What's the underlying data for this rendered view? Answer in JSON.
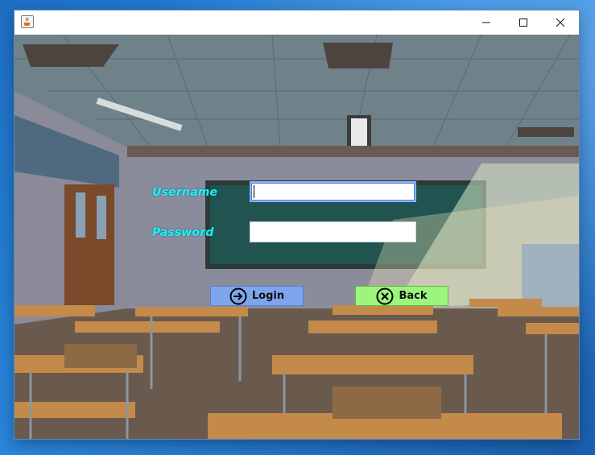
{
  "window": {
    "title": "",
    "app_icon": "java-cup-icon",
    "controls": [
      "minimize-icon",
      "maximize-icon",
      "close-icon"
    ]
  },
  "form": {
    "username_label": "Username",
    "password_label": "Password",
    "username_value": "",
    "password_value": ""
  },
  "buttons": {
    "login_label": "Login",
    "login_icon": "arrow-right-circle-icon",
    "login_color": "#7fa5ee",
    "back_label": "Back",
    "back_icon": "x-circle-icon",
    "back_color": "#9df57f"
  },
  "colors": {
    "label_color": "#19f2ff"
  }
}
